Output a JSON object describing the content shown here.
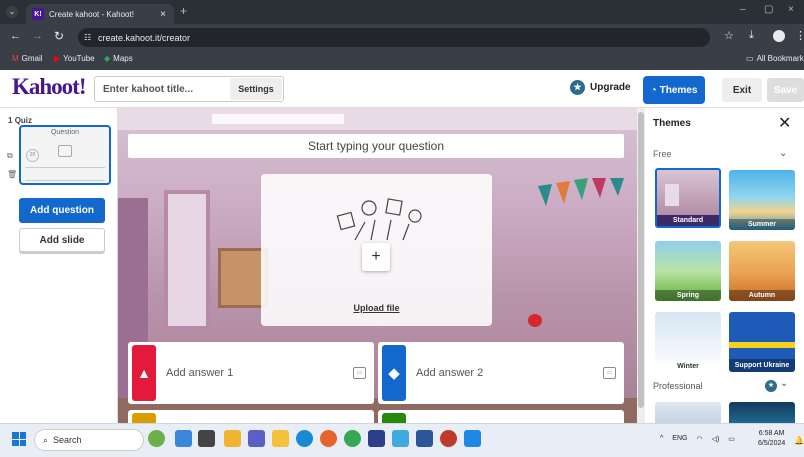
{
  "browser": {
    "tab_title": "Create kahoot - Kahoot!",
    "tab_favicon": "K!",
    "url": "create.kahoot.it/creator",
    "bookmarks": [
      "Gmail",
      "YouTube",
      "Maps"
    ],
    "all_bookmarks": "All Bookmarks"
  },
  "header": {
    "logo": "Kahoot!",
    "title_placeholder": "Enter kahoot title...",
    "settings_label": "Settings",
    "upgrade_label": "Upgrade",
    "themes_label": "Themes",
    "exit_label": "Exit",
    "save_label": "Save"
  },
  "sidebar": {
    "slide_index": "1",
    "slide_type": "Quiz",
    "thumb_label": "Question",
    "thumb_timer": "20",
    "add_question_label": "Add question",
    "add_slide_label": "Add slide"
  },
  "editor": {
    "question_placeholder": "Start typing your question",
    "upload_label": "Upload file",
    "answers": [
      {
        "label": "Add answer 1",
        "color": "#e21b3c",
        "shape": "triangle"
      },
      {
        "label": "Add answer 2",
        "color": "#1368ce",
        "shape": "diamond"
      },
      {
        "label": "",
        "color": "#d89e00",
        "shape": "circle"
      },
      {
        "label": "",
        "color": "#26890c",
        "shape": "square"
      }
    ]
  },
  "themes_panel": {
    "title": "Themes",
    "free_label": "Free",
    "professional_label": "Professional",
    "themes": [
      {
        "name": "Standard",
        "selected": true
      },
      {
        "name": "Summer",
        "selected": false
      },
      {
        "name": "Spring",
        "selected": false
      },
      {
        "name": "Autumn",
        "selected": false
      },
      {
        "name": "Winter",
        "selected": false
      },
      {
        "name": "Support Ukraine",
        "selected": false
      }
    ]
  },
  "taskbar": {
    "search_label": "Search",
    "language": "ENG",
    "time": "6:58 AM",
    "date": "6/5/2024"
  }
}
